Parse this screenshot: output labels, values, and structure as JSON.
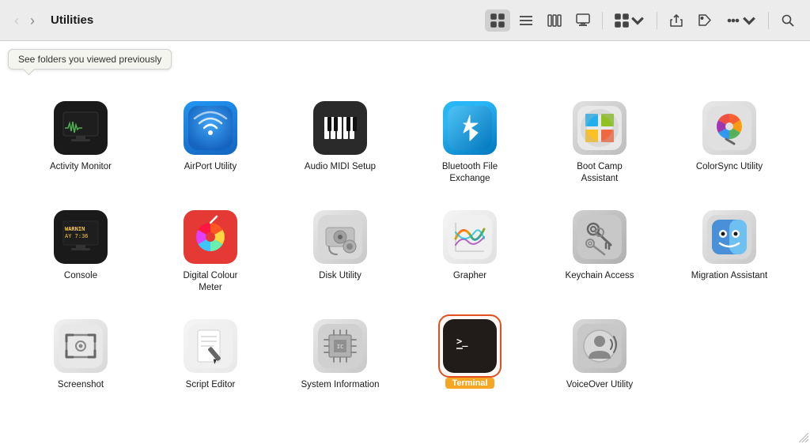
{
  "toolbar": {
    "back_label": "‹",
    "forward_label": "›",
    "title": "Utilities",
    "tooltip": "See folders you viewed previously",
    "view_grid_label": "Grid view",
    "view_list_label": "List view",
    "view_column_label": "Column view",
    "view_gallery_label": "Gallery view",
    "view_arrange_label": "Arrange",
    "share_label": "Share",
    "tag_label": "Tag",
    "more_label": "More",
    "search_label": "Search"
  },
  "apps": [
    {
      "id": "activity-monitor",
      "label": "Activity Monitor",
      "icon_type": "activity-monitor",
      "selected": false
    },
    {
      "id": "airport-utility",
      "label": "AirPort Utility",
      "icon_type": "airport",
      "selected": false
    },
    {
      "id": "audio-midi",
      "label": "Audio MIDI Setup",
      "icon_type": "audio-midi",
      "selected": false
    },
    {
      "id": "bluetooth",
      "label": "Bluetooth File Exchange",
      "icon_type": "bluetooth",
      "selected": false
    },
    {
      "id": "bootcamp",
      "label": "Boot Camp Assistant",
      "icon_type": "bootcamp",
      "selected": false
    },
    {
      "id": "colorsync",
      "label": "ColorSync Utility",
      "icon_type": "colorsync",
      "selected": false
    },
    {
      "id": "console",
      "label": "Console",
      "icon_type": "console",
      "selected": false
    },
    {
      "id": "digital-colour",
      "label": "Digital Colour Meter",
      "icon_type": "digital-colour",
      "selected": false
    },
    {
      "id": "disk-utility",
      "label": "Disk Utility",
      "icon_type": "disk-utility",
      "selected": false
    },
    {
      "id": "grapher",
      "label": "Grapher",
      "icon_type": "grapher",
      "selected": false
    },
    {
      "id": "keychain",
      "label": "Keychain Access",
      "icon_type": "keychain",
      "selected": false
    },
    {
      "id": "migration",
      "label": "Migration Assistant",
      "icon_type": "migration",
      "selected": false
    },
    {
      "id": "screenshot",
      "label": "Screenshot",
      "icon_type": "screenshot",
      "selected": false
    },
    {
      "id": "script-editor",
      "label": "Script Editor",
      "icon_type": "script-editor",
      "selected": false
    },
    {
      "id": "system-info",
      "label": "System Information",
      "icon_type": "system-info",
      "selected": false
    },
    {
      "id": "terminal",
      "label": "Terminal",
      "icon_type": "terminal",
      "selected": true
    },
    {
      "id": "voiceover",
      "label": "VoiceOver Utility",
      "icon_type": "voiceover",
      "selected": false
    }
  ]
}
